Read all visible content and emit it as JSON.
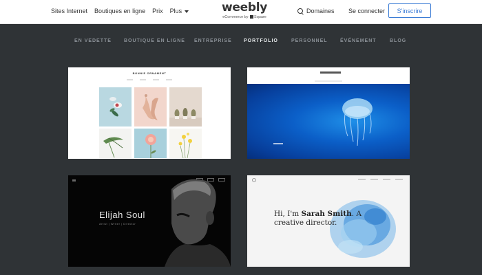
{
  "header": {
    "nav": [
      "Sites Internet",
      "Boutiques en ligne",
      "Prix",
      "Plus"
    ],
    "logo": "weebly",
    "logo_sub": "eCommerce by",
    "logo_sub_brand": "Square",
    "domains": "Domaines",
    "login": "Se connecter",
    "signup": "S'inscrire"
  },
  "tabs": [
    {
      "label": "EN VEDETTE",
      "active": false
    },
    {
      "label": "BOUTIQUE EN LIGNE",
      "active": false
    },
    {
      "label": "ENTREPRISE",
      "active": false
    },
    {
      "label": "PORTFOLIO",
      "active": true
    },
    {
      "label": "PERSONNEL",
      "active": false
    },
    {
      "label": "ÉVÉNEMENT",
      "active": false
    },
    {
      "label": "BLOG",
      "active": false
    }
  ],
  "templates": {
    "t1_title": "BONNIE ORNAMENT",
    "t3_name": "Elijah Soul",
    "t3_sub": "Artist | Writer | Director",
    "t4_line1": "Hi, I'm ",
    "t4_name": "Sarah Smith",
    "t4_line2": ". A creative director."
  },
  "colors": {
    "accent": "#3a7bd5",
    "page_bg": "#2f3336"
  }
}
